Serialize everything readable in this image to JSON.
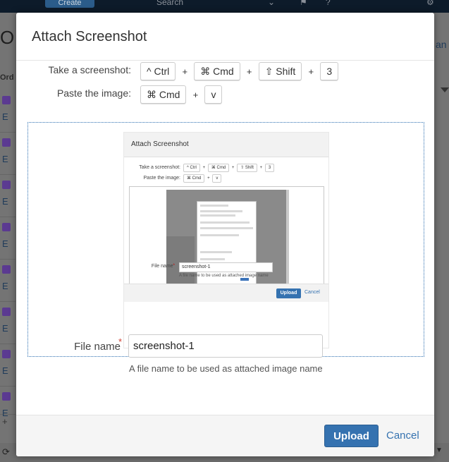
{
  "background": {
    "create_label": "Create",
    "search_label": "Search",
    "left_heading_partial": "O",
    "left_column_header": "Ord",
    "row_letter": "E",
    "right_link_partial": "an",
    "add_label": "+",
    "icons": [
      "help-icon",
      "user-menu-icon",
      "settings-icon",
      "refresh-icon",
      "dropdown-icon"
    ]
  },
  "dialog": {
    "title": "Attach Screenshot",
    "instructions": {
      "take": {
        "label": "Take a screenshot:",
        "keys": [
          "^ Ctrl",
          "⌘ Cmd",
          "⇧ Shift",
          "3"
        ],
        "separator": "+"
      },
      "paste": {
        "label": "Paste the image:",
        "keys": [
          "⌘ Cmd",
          "v"
        ],
        "separator": "+"
      }
    },
    "preview": {
      "title": "Attach Screenshot",
      "take_label": "Take a screenshot:",
      "take_keys": [
        "^ Ctrl",
        "⌘ Cmd",
        "⇧ Shift",
        "3"
      ],
      "paste_label": "Paste the image:",
      "paste_keys": [
        "⌘ Cmd",
        "v"
      ],
      "file_name_label": "File name",
      "file_name_value": "screenshot-1",
      "file_name_help": "A file name to be used as attached image name",
      "upload_label": "Upload",
      "cancel_label": "Cancel"
    },
    "file_name": {
      "label": "File name",
      "required_marker": "*",
      "value": "screenshot-1",
      "help": "A file name to be used as attached image name"
    },
    "footer": {
      "upload_label": "Upload",
      "cancel_label": "Cancel"
    }
  },
  "colors": {
    "primary": "#3572b0",
    "required": "#d04437",
    "drop_zone_border": "#2d6fb1",
    "overlay": "#747474"
  }
}
